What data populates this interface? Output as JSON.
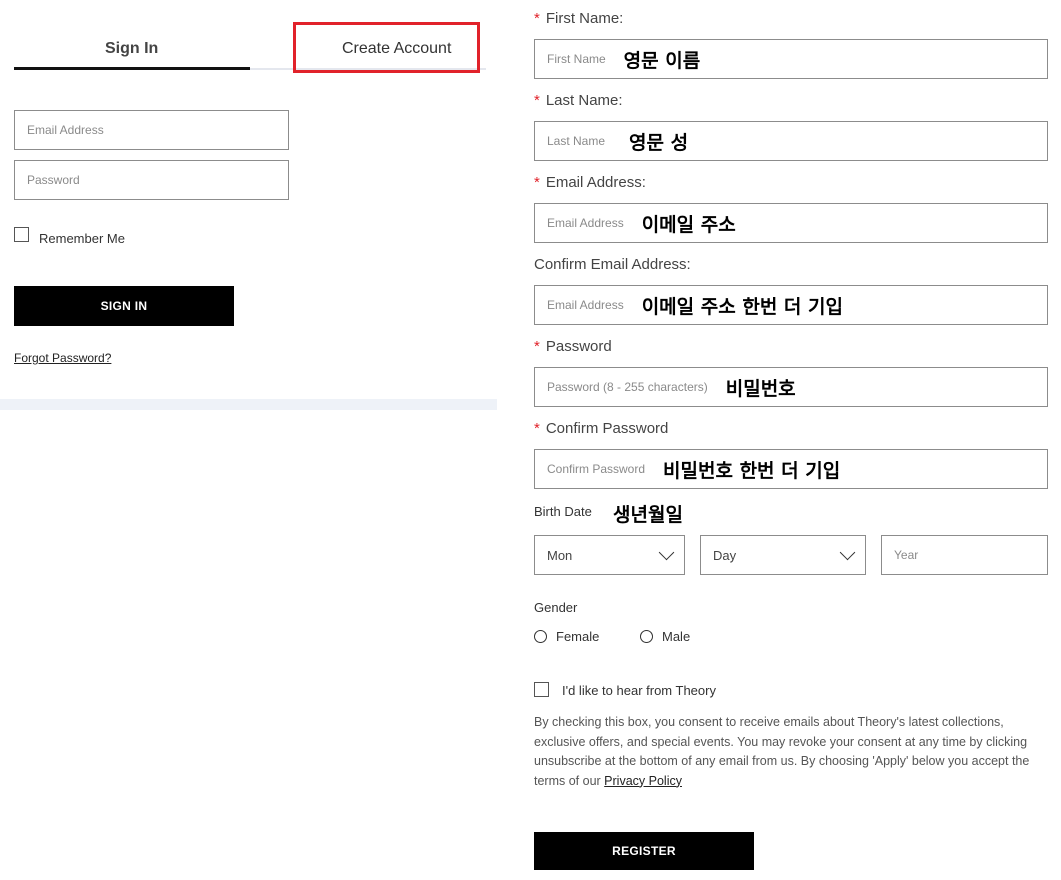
{
  "tabs": {
    "sign_in": "Sign In",
    "create_account": "Create Account"
  },
  "login": {
    "email_placeholder": "Email Address",
    "password_placeholder": "Password",
    "remember_label": "Remember Me",
    "sign_in_button": "SIGN IN",
    "forgot_password": "Forgot Password?"
  },
  "register": {
    "required_marker": "*",
    "first_name": {
      "label": "First Name:",
      "placeholder": "First Name",
      "annotation": "영문 이름"
    },
    "last_name": {
      "label": "Last Name:",
      "placeholder": "Last Name",
      "annotation": "영문 성"
    },
    "email": {
      "label": "Email Address:",
      "placeholder": "Email Address",
      "annotation": "이메일 주소"
    },
    "confirm_email": {
      "label": "Confirm Email Address:",
      "placeholder": "Email Address",
      "annotation": "이메일 주소 한번 더 기입"
    },
    "password": {
      "label": "Password",
      "placeholder": "Password (8 - 255 characters)",
      "annotation": "비밀번호"
    },
    "confirm_password": {
      "label": "Confirm Password",
      "placeholder": "Confirm Password",
      "annotation": "비밀번호 한번 더 기입"
    },
    "birth_date": {
      "label": "Birth Date",
      "annotation": "생년월일",
      "month": "Mon",
      "day": "Day",
      "year_placeholder": "Year"
    },
    "gender": {
      "label": "Gender",
      "female": "Female",
      "male": "Male"
    },
    "optin_label": "I'd like to hear from Theory",
    "consent_text": "By checking this box, you consent to receive emails about Theory's latest collections, exclusive offers, and special events. You may revoke your consent at any time by clicking unsubscribe at the bottom of any email from us. By choosing 'Apply' below you accept the terms of our ",
    "privacy_policy": "Privacy Policy",
    "register_button": "REGISTER"
  },
  "colors": {
    "highlight": "#e1222a",
    "required": "#e1222a",
    "button_bg": "#000000"
  }
}
